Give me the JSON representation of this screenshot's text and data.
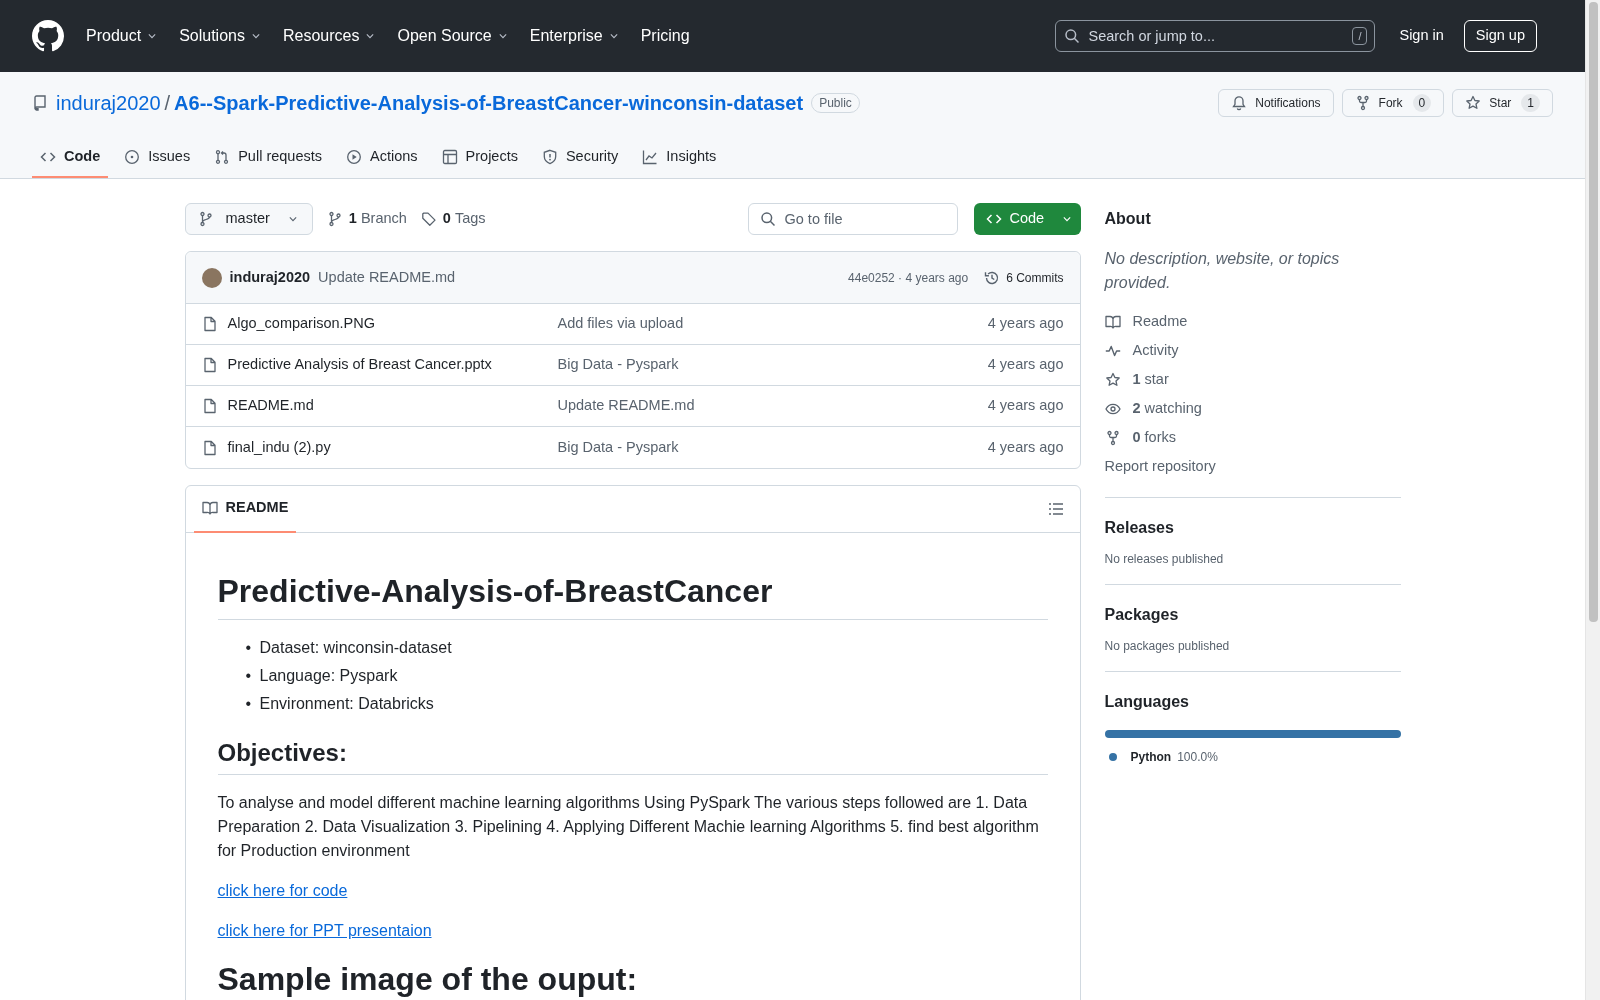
{
  "header": {
    "nav": [
      {
        "label": "Product",
        "has_menu": true
      },
      {
        "label": "Solutions",
        "has_menu": true
      },
      {
        "label": "Resources",
        "has_menu": true
      },
      {
        "label": "Open Source",
        "has_menu": true
      },
      {
        "label": "Enterprise",
        "has_menu": true
      },
      {
        "label": "Pricing",
        "has_menu": false
      }
    ],
    "search": {
      "placeholder": "Search or jump to...",
      "shortcut": "/"
    },
    "sign_in": "Sign in",
    "sign_up": "Sign up"
  },
  "repo": {
    "owner": "induraj2020",
    "separator": "/",
    "name": "A6--Spark-Predictive-Analysis-of-BreastCancer-winconsin-dataset",
    "visibility": "Public",
    "actions": [
      {
        "kind": "notifications",
        "label": "Notifications"
      },
      {
        "kind": "fork",
        "label": "Fork",
        "count": "0"
      },
      {
        "kind": "star",
        "label": "Star",
        "count": "1"
      }
    ]
  },
  "tabs": [
    {
      "kind": "code",
      "label": "Code",
      "selected": true
    },
    {
      "kind": "issues",
      "label": "Issues",
      "selected": false
    },
    {
      "kind": "pulls",
      "label": "Pull requests",
      "selected": false
    },
    {
      "kind": "actions",
      "label": "Actions",
      "selected": false
    },
    {
      "kind": "projects",
      "label": "Projects",
      "selected": false
    },
    {
      "kind": "security",
      "label": "Security",
      "selected": false
    },
    {
      "kind": "insights",
      "label": "Insights",
      "selected": false
    }
  ],
  "toolbar": {
    "branch": "master",
    "branches_count": "1",
    "branches_label": "Branch",
    "tags_count": "0",
    "tags_label": "Tags",
    "go_to_file": {
      "placeholder": "Go to file"
    },
    "code_button": "Code"
  },
  "latest_commit": {
    "author": "induraj2020",
    "message": "Update README.md",
    "meta": "44e0252 · 4 years ago",
    "commits": "6 Commits"
  },
  "files": [
    {
      "name": "Algo_comparison.PNG",
      "message": "Add files via upload",
      "time": "4 years ago"
    },
    {
      "name": "Predictive Analysis of Breast Cancer.pptx",
      "message": "Big Data - Pyspark",
      "time": "4 years ago"
    },
    {
      "name": "README.md",
      "message": "Update README.md",
      "time": "4 years ago"
    },
    {
      "name": "final_indu (2).py",
      "message": "Big Data - Pyspark",
      "time": "4 years ago"
    }
  ],
  "readme": {
    "tab": "README",
    "blocks": [
      {
        "kind": "h1",
        "text": "Predictive-Analysis-of-BreastCancer"
      },
      {
        "kind": "list",
        "marker": "•",
        "items": [
          "Dataset: winconsin-dataset",
          "Language: Pyspark",
          "Environment: Databricks"
        ]
      },
      {
        "kind": "h2",
        "text": "Objectives:"
      },
      {
        "kind": "p",
        "text": "To analyse and model different machine learning algorithms Using PySpark The various steps followed are 1. Data Preparation 2. Data Visualization 3. Pipelining 4. Applying Different Machie learning Algorithms 5. find best algorithm for Production environment"
      },
      {
        "kind": "link",
        "text": "click here for code"
      },
      {
        "kind": "link",
        "text": "click here for PPT presentaion"
      },
      {
        "kind": "h1",
        "text": "Sample image of the ouput:"
      }
    ]
  },
  "about": {
    "title": "About",
    "description": "No description, website, or topics provided.",
    "items": [
      {
        "kind": "readme",
        "label": "Readme"
      },
      {
        "kind": "activity",
        "label": "Activity"
      },
      {
        "kind": "star",
        "count": "1",
        "label": "star"
      },
      {
        "kind": "watch",
        "count": "2",
        "label": "watching"
      },
      {
        "kind": "fork",
        "count": "0",
        "label": "forks"
      }
    ],
    "report": "Report repository"
  },
  "releases": {
    "title": "Releases",
    "note": "No releases published"
  },
  "packages": {
    "title": "Packages",
    "note": "No packages published"
  },
  "languages": {
    "title": "Languages",
    "items": [
      {
        "name": "Python",
        "percent": "100.0%",
        "level": 1,
        "color": "#3572a5"
      }
    ]
  }
}
